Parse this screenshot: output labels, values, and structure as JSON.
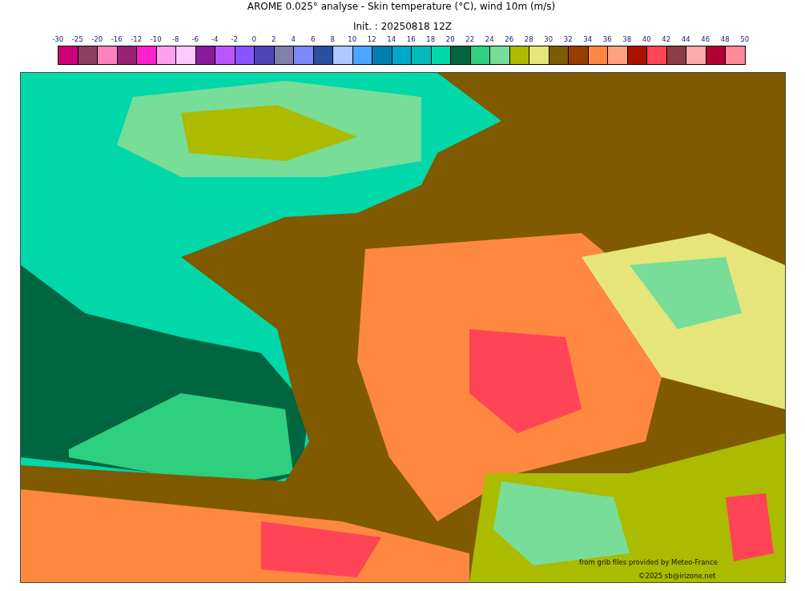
{
  "title": "AROME 0.025° analyse - Skin temperature (°C), wind 10m (m/s)",
  "subtitle": "Init. : 20250818 12Z",
  "colorbar": {
    "labels": [
      "-30",
      "-25",
      "-20",
      "-16",
      "-12",
      "-10",
      "-8",
      "-6",
      "-4",
      "-2",
      "0",
      "2",
      "4",
      "6",
      "8",
      "10",
      "12",
      "14",
      "16",
      "18",
      "20",
      "22",
      "24",
      "26",
      "28",
      "30",
      "32",
      "34",
      "36",
      "38",
      "40",
      "42",
      "44",
      "46",
      "48",
      "50"
    ],
    "swatches": [
      {
        "color": "#cc0077"
      },
      {
        "color": "#8b4060"
      },
      {
        "color": "#ff80c0"
      },
      {
        "color": "#992277"
      },
      {
        "color": "#ff22cc"
      },
      {
        "color": "#ffa0ee"
      },
      {
        "color": "#ffc8ff"
      },
      {
        "color": "#8b1a9b"
      },
      {
        "color": "#bb55ff"
      },
      {
        "color": "#8855ff"
      },
      {
        "color": "#5044bb"
      },
      {
        "color": "#8080aa"
      },
      {
        "color": "#8088ff"
      },
      {
        "color": "#2b50a0"
      },
      {
        "color": "#b0c8ff"
      },
      {
        "color": "#4da6ff"
      },
      {
        "color": "#0080b0"
      },
      {
        "color": "#00a8cc"
      },
      {
        "color": "#00bbbb"
      },
      {
        "color": "#00d8aa"
      },
      {
        "color": "#006640"
      },
      {
        "color": "#2ed080"
      },
      {
        "color": "#77dd99"
      },
      {
        "color": "#aabb00"
      },
      {
        "color": "#e5e57a"
      },
      {
        "color": "#7f5a00"
      },
      {
        "color": "#993d00"
      },
      {
        "color": "#ff8840"
      },
      {
        "color": "#ffa080"
      },
      {
        "color": "#aa1100"
      },
      {
        "color": "#ff4455"
      },
      {
        "color": "#8b3f44"
      },
      {
        "color": "#ffaaaa"
      },
      {
        "color": "#b20033"
      },
      {
        "color": "#ff8899"
      }
    ]
  },
  "map": {
    "credits": [
      "from grib files provided by Meteo-France",
      "©2025 sb@irizone.net"
    ]
  }
}
